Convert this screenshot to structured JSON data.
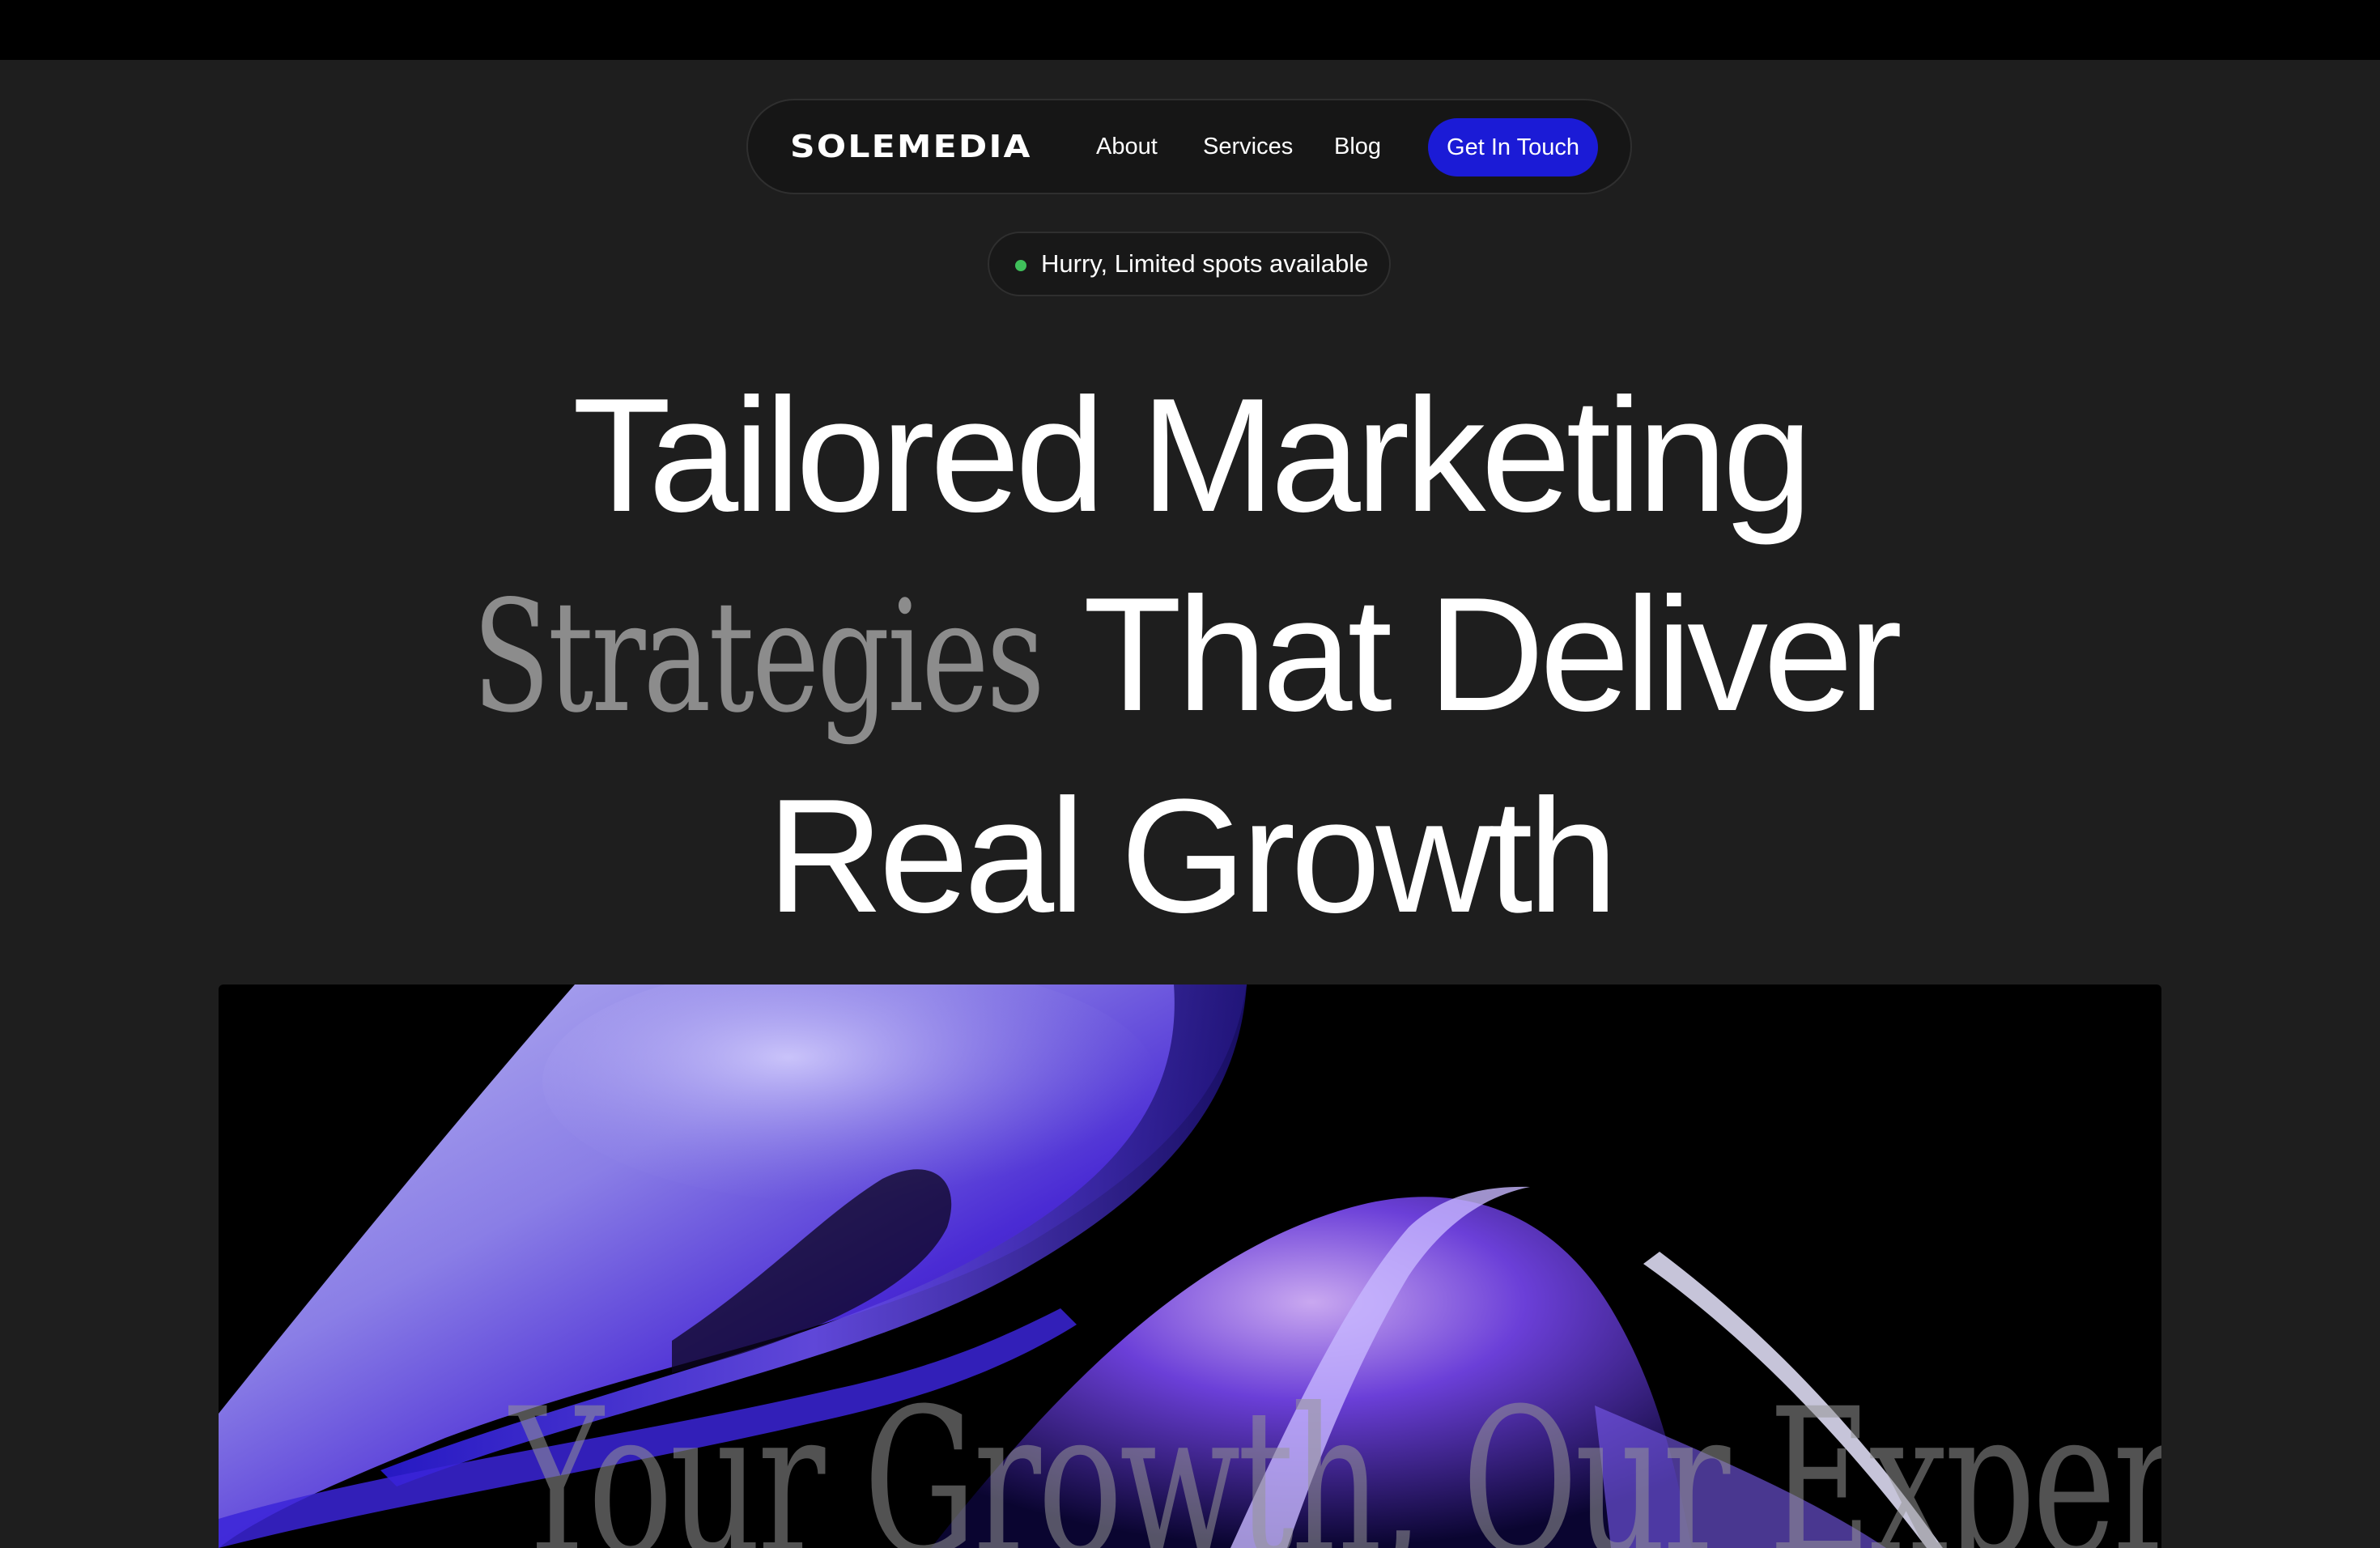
{
  "nav": {
    "logo": "SOLEMEDIA",
    "links": [
      "About",
      "Services",
      "Blog"
    ],
    "cta_label": "Get In Touch"
  },
  "badge": {
    "text": "Hurry, Limited spots available",
    "dot_color": "#3fbf5a"
  },
  "headline": {
    "line1": "Tailored Marketing",
    "line2_serif": "Strategies",
    "line2_rest": "That Deliver",
    "line3": "Real Growth"
  },
  "hero": {
    "caption": "Your Growth, Our Expertise"
  },
  "colors": {
    "background": "#1e1e1e",
    "accent": "#1b1bd6",
    "top_bar": "#000000"
  }
}
